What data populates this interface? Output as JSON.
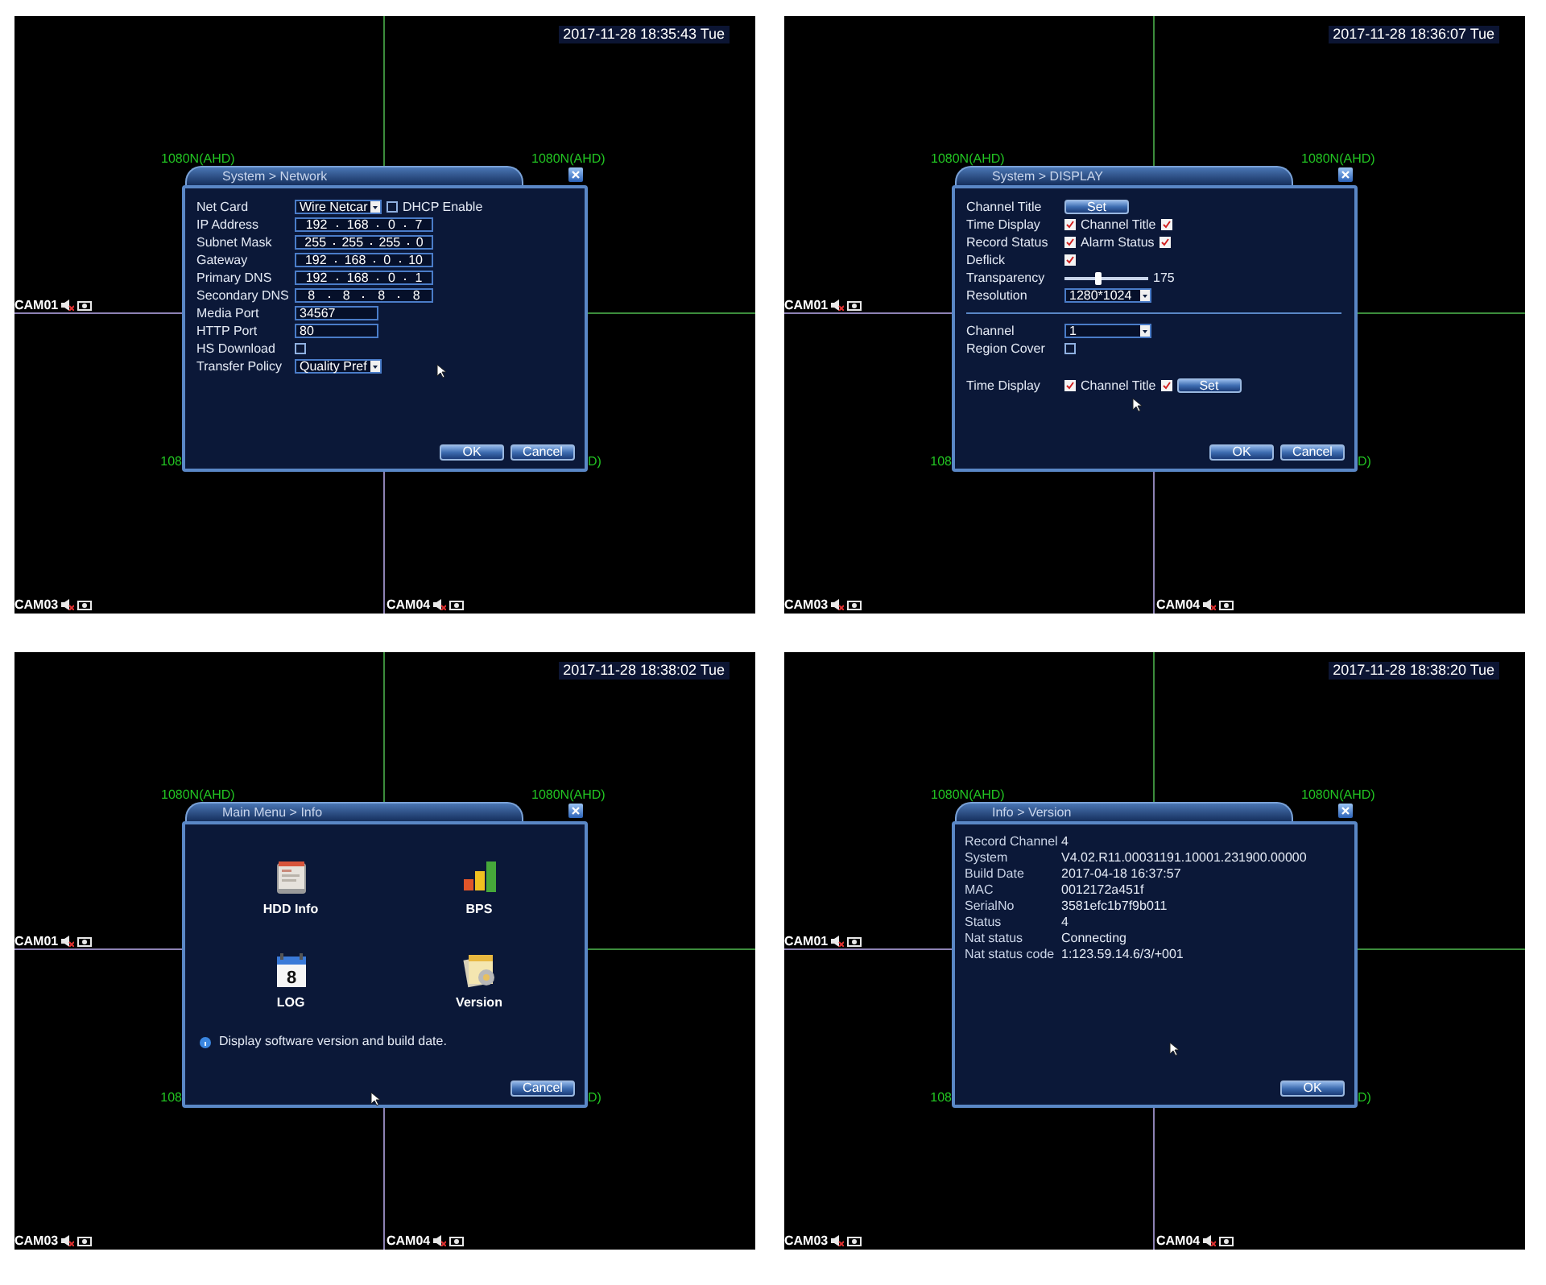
{
  "screens": [
    {
      "timestamp": "2017-11-28 18:35:43 Tue",
      "channel_labels": [
        "1080N(AHD)",
        "1080N(AHD)",
        "108",
        "D)"
      ],
      "cameras": [
        "CAM01",
        "CAM03",
        "CAM04"
      ],
      "dialog": {
        "kind": "form",
        "title": "System > Network",
        "sections": [
          {
            "rows": [
              {
                "cells": [
                  {
                    "kind": "label",
                    "text": "Net Card"
                  },
                  {
                    "kind": "select",
                    "value": "Wire Netcar"
                  },
                  {
                    "kind": "checkbox",
                    "checked": false
                  },
                  {
                    "kind": "label",
                    "text": "DHCP Enable"
                  }
                ]
              },
              {
                "cells": [
                  {
                    "kind": "label",
                    "text": "IP Address"
                  },
                  {
                    "kind": "ip",
                    "octets": [
                      "192",
                      "168",
                      "0",
                      "7"
                    ]
                  }
                ]
              },
              {
                "cells": [
                  {
                    "kind": "label",
                    "text": "Subnet Mask"
                  },
                  {
                    "kind": "ip",
                    "octets": [
                      "255",
                      "255",
                      "255",
                      "0"
                    ]
                  }
                ]
              },
              {
                "cells": [
                  {
                    "kind": "label",
                    "text": "Gateway"
                  },
                  {
                    "kind": "ip",
                    "octets": [
                      "192",
                      "168",
                      "0",
                      "10"
                    ]
                  }
                ]
              },
              {
                "cells": [
                  {
                    "kind": "label",
                    "text": "Primary DNS"
                  },
                  {
                    "kind": "ip",
                    "octets": [
                      "192",
                      "168",
                      "0",
                      "1"
                    ]
                  }
                ]
              },
              {
                "cells": [
                  {
                    "kind": "label",
                    "text": "Secondary DNS"
                  },
                  {
                    "kind": "ip",
                    "octets": [
                      "8",
                      "8",
                      "8",
                      "8"
                    ]
                  }
                ]
              },
              {
                "cells": [
                  {
                    "kind": "label",
                    "text": "Media Port"
                  },
                  {
                    "kind": "text",
                    "value": "34567"
                  }
                ]
              },
              {
                "cells": [
                  {
                    "kind": "label",
                    "text": "HTTP Port"
                  },
                  {
                    "kind": "text",
                    "value": "80"
                  }
                ]
              },
              {
                "cells": [
                  {
                    "kind": "label",
                    "text": "HS Download"
                  },
                  {
                    "kind": "checkbox",
                    "checked": false
                  }
                ]
              },
              {
                "cells": [
                  {
                    "kind": "label",
                    "text": "Transfer Policy"
                  },
                  {
                    "kind": "select",
                    "value": "Quality Pref"
                  }
                ]
              }
            ]
          }
        ],
        "buttons": [
          "OK",
          "Cancel"
        ]
      }
    },
    {
      "timestamp": "2017-11-28 18:36:07 Tue",
      "channel_labels": [
        "1080N(AHD)",
        "1080N(AHD)",
        "108",
        "D)"
      ],
      "cameras": [
        "CAM01",
        "CAM03",
        "CAM04"
      ],
      "dialog": {
        "kind": "form",
        "title": "System > DISPLAY",
        "sections": [
          {
            "rows": [
              {
                "cells": [
                  {
                    "kind": "label",
                    "text": "Channel Title"
                  },
                  {
                    "kind": "button",
                    "text": "Set"
                  }
                ]
              },
              {
                "cells": [
                  {
                    "kind": "label",
                    "text": "Time Display"
                  },
                  {
                    "kind": "checkbox",
                    "checked": true
                  },
                  {
                    "kind": "label",
                    "text": "Channel Title"
                  },
                  {
                    "kind": "checkbox",
                    "checked": true
                  }
                ]
              },
              {
                "cells": [
                  {
                    "kind": "label",
                    "text": "Record Status"
                  },
                  {
                    "kind": "checkbox",
                    "checked": true
                  },
                  {
                    "kind": "label",
                    "text": "Alarm Status"
                  },
                  {
                    "kind": "checkbox",
                    "checked": true
                  }
                ]
              },
              {
                "cells": [
                  {
                    "kind": "label",
                    "text": "Deflick"
                  },
                  {
                    "kind": "checkbox",
                    "checked": true
                  }
                ]
              },
              {
                "cells": [
                  {
                    "kind": "label",
                    "text": "Transparency"
                  },
                  {
                    "kind": "slider",
                    "level": 0.4
                  },
                  {
                    "kind": "value",
                    "text": "175"
                  }
                ]
              },
              {
                "cells": [
                  {
                    "kind": "label",
                    "text": "Resolution"
                  },
                  {
                    "kind": "select",
                    "value": "1280*1024"
                  }
                ]
              }
            ]
          },
          {
            "divider": true,
            "rows": [
              {
                "cells": [
                  {
                    "kind": "label",
                    "text": "Channel"
                  },
                  {
                    "kind": "select",
                    "value": "1"
                  }
                ]
              },
              {
                "cells": [
                  {
                    "kind": "label",
                    "text": "Region Cover"
                  },
                  {
                    "kind": "checkbox",
                    "checked": false
                  }
                ]
              }
            ]
          },
          {
            "divider": false,
            "rows": [
              {
                "cells": [
                  {
                    "kind": "label",
                    "text": "Time Display"
                  },
                  {
                    "kind": "checkbox",
                    "checked": true
                  },
                  {
                    "kind": "label",
                    "text": "Channel Title"
                  },
                  {
                    "kind": "checkbox",
                    "checked": true
                  },
                  {
                    "kind": "button",
                    "text": "Set"
                  }
                ]
              }
            ]
          }
        ],
        "buttons": [
          "OK",
          "Cancel"
        ]
      }
    },
    {
      "timestamp": "2017-11-28 18:38:02 Tue",
      "channel_labels": [
        "1080N(AHD)",
        "1080N(AHD)",
        "108",
        "D)"
      ],
      "cameras": [
        "CAM01",
        "CAM03",
        "CAM04"
      ],
      "dialog": {
        "kind": "menu",
        "title": "Main Menu > Info",
        "items": [
          {
            "label": "HDD Info"
          },
          {
            "label": "BPS"
          },
          {
            "label": "LOG",
            "icon_text": "8"
          },
          {
            "label": "Version"
          }
        ],
        "hint": "Display software version and build date.",
        "buttons": [
          "Cancel"
        ]
      }
    },
    {
      "timestamp": "2017-11-28 18:38:20 Tue",
      "channel_labels": [
        "1080N(AHD)",
        "1080N(AHD)",
        "108",
        "D)"
      ],
      "cameras": [
        "CAM01",
        "CAM03",
        "CAM04"
      ],
      "dialog": {
        "kind": "info",
        "title": "Info > Version",
        "rows": [
          {
            "label": "Record Channel",
            "value": "4"
          },
          {
            "label": "System",
            "value": "V4.02.R11.00031191.10001.231900.00000"
          },
          {
            "label": "Build Date",
            "value": "2017-04-18 16:37:57"
          },
          {
            "label": "MAC",
            "value": "0012172a451f"
          },
          {
            "label": "SerialNo",
            "value": "3581efc1b7f9b011"
          },
          {
            "label": "Status",
            "value": "4"
          },
          {
            "label": "Nat status",
            "value": "Connecting"
          },
          {
            "label": "Nat status code",
            "value": "1:123.59.14.6/3/+001"
          }
        ],
        "buttons": [
          "OK"
        ]
      }
    }
  ]
}
